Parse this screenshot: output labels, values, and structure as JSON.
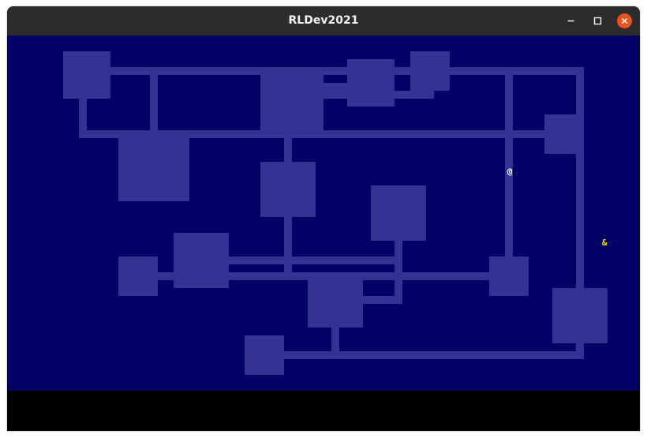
{
  "window": {
    "title": "RLDev2021",
    "controls": [
      "minimize-icon",
      "maximize-icon",
      "close-icon"
    ],
    "close_color": "#e95420"
  },
  "map": {
    "floor_color": "#000066",
    "lit_color": "#333394",
    "player": {
      "glyph": "@",
      "color": "#ffffff"
    },
    "monster": {
      "glyph": "&",
      "color": "#f0e000"
    }
  },
  "message_log": {
    "background": "#000000"
  }
}
